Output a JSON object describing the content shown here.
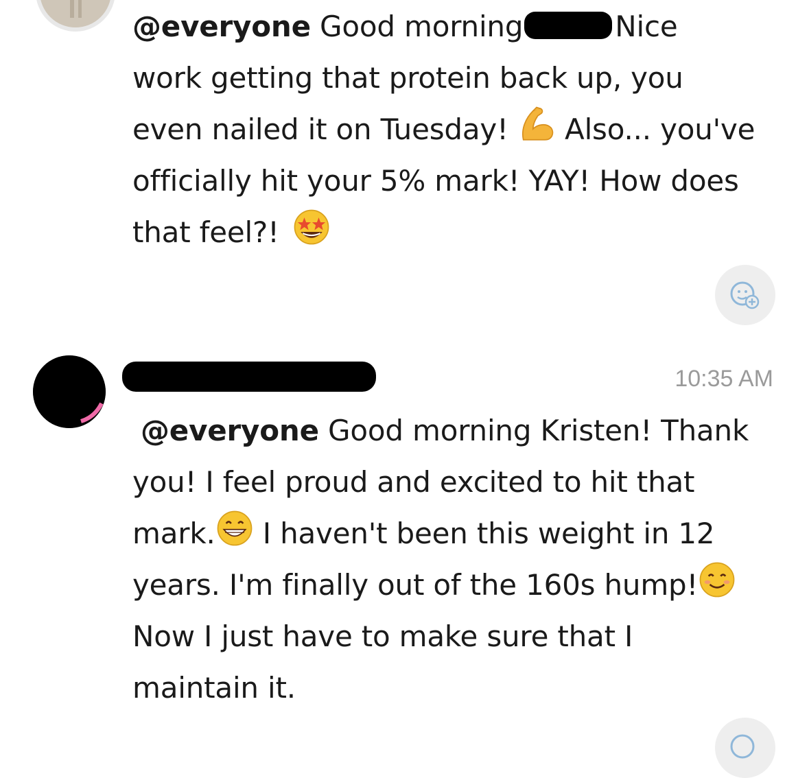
{
  "messages": [
    {
      "mention": "@everyone",
      "line1_after_mention": " Good morning",
      "line1_tail": "Nice",
      "line2": "work getting that protein back up, you",
      "line3a": "even nailed it on Tuesday!",
      "line3b": " Also... you've",
      "line4": "officially hit your 5% mark! YAY! How does",
      "line5": "that feel?!",
      "emojis": [
        "flexed-biceps",
        "star-struck"
      ]
    },
    {
      "timestamp": "10:35 AM",
      "mention": "@everyone",
      "line1_after_mention": " Good morning Kristen! Thank",
      "line2": "you! I feel proud and excited to hit that",
      "line3a": "mark.",
      "line3b": " I haven't been this weight in 12",
      "line4a": "years. I'm finally out of the 160s hump!",
      "line5": "Now I just have to make sure that I",
      "line6": "maintain it.",
      "emojis": [
        "grinning-face",
        "smiling-face"
      ]
    }
  ],
  "icons": {
    "add_reaction": "add-reaction-icon"
  },
  "colors": {
    "text": "#1a1a1a",
    "timestamp": "#9a9a9a",
    "reaction_bg": "#eeeeee",
    "redaction": "#000000"
  }
}
